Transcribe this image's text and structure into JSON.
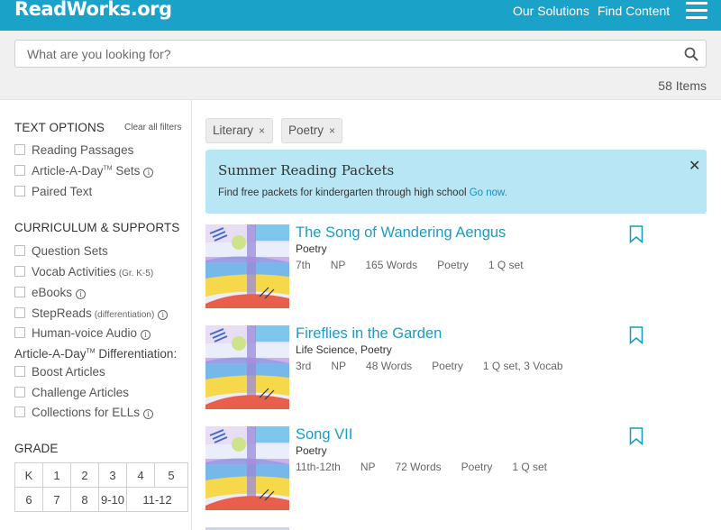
{
  "header": {
    "logo": "ReadWorks.org",
    "nav": [
      "Our Solutions",
      "Find Content"
    ],
    "menu_icon": "hamburger-icon",
    "bg_color": "#1aa2c8"
  },
  "search": {
    "placeholder": "What are you looking for?",
    "value": "",
    "icon": "search-icon",
    "result_count": "58 Items"
  },
  "sidebar": {
    "text_options": {
      "title": "TEXT OPTIONS",
      "clear": "Clear all filters",
      "items": [
        "Reading Passages",
        "Article-A-Day",
        "Paired Text"
      ],
      "article_suffix": "Sets",
      "tm": "TM"
    },
    "curriculum": {
      "title": "CURRICULUM & SUPPORTS",
      "items": [
        "Question Sets",
        "Vocab Activities",
        "eBooks",
        "StepReads",
        "Human-voice Audio"
      ],
      "vocab_note": "(Gr. K-5)",
      "stepreads_note": "(differentiation)"
    },
    "differentiation": {
      "title_a": "Article-A-Day",
      "title_b": "Differentiation:",
      "items": [
        "Boost Articles",
        "Challenge Articles",
        "Collections for ELLs"
      ]
    },
    "grade": {
      "title": "GRADE",
      "row1": [
        "K",
        "1",
        "2",
        "3",
        "4",
        "5"
      ],
      "row2": [
        "6",
        "7",
        "8",
        "9-10",
        "11-12"
      ]
    }
  },
  "filters": [
    {
      "label": "Literary",
      "remove": "×"
    },
    {
      "label": "Poetry",
      "remove": "×"
    }
  ],
  "banner": {
    "title": "Summer Reading Packets",
    "body": "Find free packets for kindergarten through high school",
    "link": "Go now.",
    "close": "✕"
  },
  "results": [
    {
      "title": "The Song of Wandering Aengus",
      "genre": "Poetry",
      "grade": "7th",
      "lexile": "NP",
      "words": "165 Words",
      "type": "Poetry",
      "extras": "1 Q set"
    },
    {
      "title": "Fireflies in the Garden",
      "genre": "Life Science, Poetry",
      "grade": "3rd",
      "lexile": "NP",
      "words": "48 Words",
      "type": "Poetry",
      "extras": "1 Q set, 3 Vocab"
    },
    {
      "title": "Song VII",
      "genre": "Poetry",
      "grade": "11th-12th",
      "lexile": "NP",
      "words": "72 Words",
      "type": "Poetry",
      "extras": "1 Q set"
    }
  ]
}
